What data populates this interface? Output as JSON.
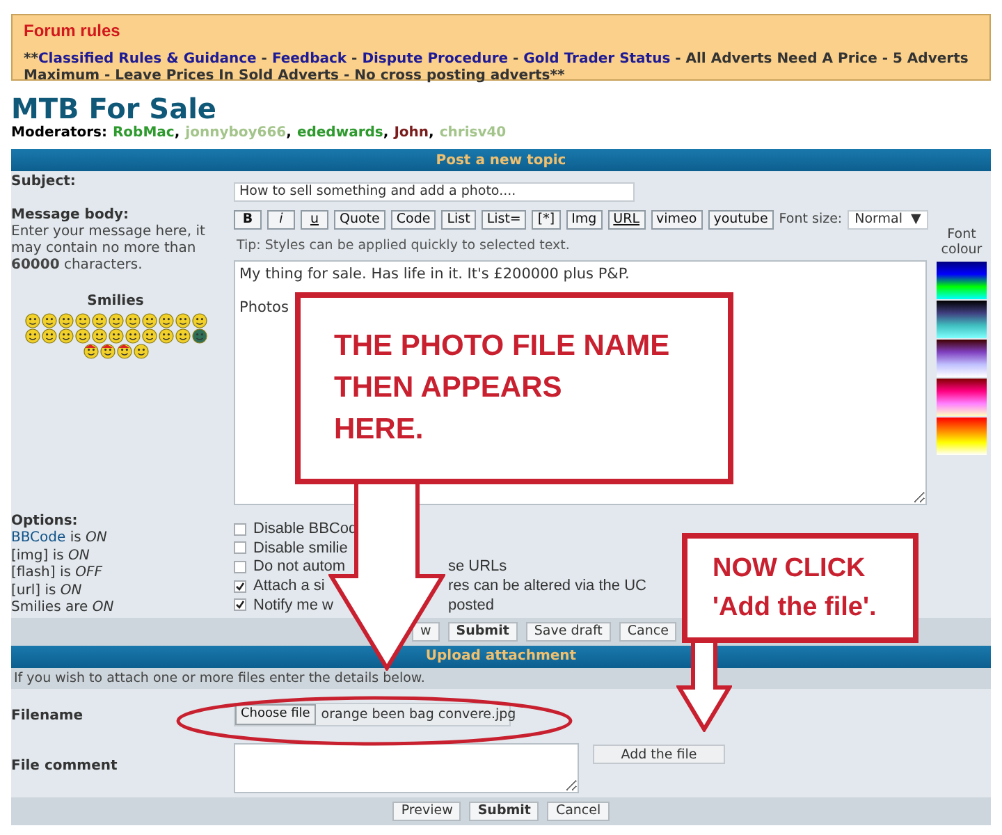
{
  "forum_rules": {
    "title": "Forum rules",
    "parts": [
      {
        "kind": "text",
        "text": "**"
      },
      {
        "kind": "link",
        "text": "Classified Rules & Guidance"
      },
      {
        "kind": "text",
        "text": " - "
      },
      {
        "kind": "link",
        "text": "Feedback"
      },
      {
        "kind": "text",
        "text": " - "
      },
      {
        "kind": "link",
        "text": "Dispute Procedure"
      },
      {
        "kind": "text",
        "text": " - "
      },
      {
        "kind": "link",
        "text": "Gold Trader Status"
      },
      {
        "kind": "text",
        "text": " - All Adverts Need A Price - 5 Adverts Maximum - Leave Prices In Sold Adverts - No cross posting adverts**"
      }
    ]
  },
  "forum_title": "MTB For Sale",
  "moderators": {
    "label": "Moderators:",
    "names": [
      {
        "name": "RobMac",
        "color": "#2e9a2e",
        "separator": ","
      },
      {
        "name": "jonnyboy666",
        "color": "#a3c48a",
        "separator": ","
      },
      {
        "name": "ededwards",
        "color": "#2e9a2e",
        "separator": ","
      },
      {
        "name": "John",
        "color": "#7a1c1c",
        "separator": ","
      },
      {
        "name": "chrisv40",
        "color": "#a3c48a"
      }
    ]
  },
  "post_panel": {
    "title": "Post a new topic",
    "subject": {
      "label": "Subject:",
      "value": "How to sell something and add a photo...."
    },
    "message_body": {
      "label": "Message body:",
      "description": "Enter your message here, it may contain no more than **60000** characters."
    },
    "smilies_title": "Smilies",
    "toolbar": [
      {
        "label": "B",
        "kind": "bold"
      },
      {
        "label": "i",
        "kind": "italic"
      },
      {
        "label": "u",
        "kind": "underline"
      },
      {
        "label": "Quote",
        "kind": "plain"
      },
      {
        "label": "Code",
        "kind": "plain"
      },
      {
        "label": "List",
        "kind": "plain"
      },
      {
        "label": "List=",
        "kind": "plain"
      },
      {
        "label": "[*]",
        "kind": "plain"
      },
      {
        "label": "Img",
        "kind": "plain"
      },
      {
        "label": "URL",
        "kind": "underline"
      },
      {
        "label": "vimeo",
        "kind": "plain"
      },
      {
        "label": "youtube",
        "kind": "plain"
      }
    ],
    "font_size": {
      "label": "Font size:",
      "value": "Normal",
      "arrow": "▼"
    },
    "tip": "Tip: Styles can be applied quickly to selected text.",
    "font_colour_label": "Font colour",
    "message": "My thing for sale. Has life in it. It's £200000 plus P&P.\n\nPhotos",
    "options": {
      "label": "Options:",
      "items": [
        {
          "link": "BBCode",
          "text": " is *ON*"
        },
        {
          "text": "[img] is *ON*"
        },
        {
          "text": "[flash] is *OFF*"
        },
        {
          "text": "[url] is *ON*"
        },
        {
          "text": "Smilies are *ON*"
        }
      ]
    },
    "checkboxes": [
      {
        "text": "Disable BBCod",
        "checked": false
      },
      {
        "text": "Disable smilie",
        "checked": false
      },
      {
        "text": "Do not autom",
        "text_after": "se URLs",
        "checked": false
      },
      {
        "text": "Attach a si",
        "text_after": "res can be altered via the UC",
        "checked": true
      },
      {
        "text": "Notify me w",
        "text_after": "posted",
        "checked": true
      }
    ],
    "buttons": [
      {
        "label": "w",
        "kind": "normal"
      },
      {
        "label": "Submit",
        "kind": "primary"
      },
      {
        "label": "Save draft",
        "kind": "normal"
      },
      {
        "label": "Cance",
        "kind": "normal"
      }
    ]
  },
  "upload_panel": {
    "title": "Upload attachment",
    "info": "If you wish to attach one or more files enter the details below.",
    "filename_label": "Filename",
    "choose_button": "Choose file",
    "file_name": "orange been bag convere.jpg",
    "add_button": "Add the file",
    "comment_label": "File comment",
    "buttons": [
      {
        "label": "Preview",
        "kind": "normal"
      },
      {
        "label": "Submit",
        "kind": "primary"
      },
      {
        "label": "Cancel",
        "kind": "normal"
      }
    ]
  },
  "annotations": [
    {
      "kind": "callout",
      "lines": [
        "THE PHOTO FILE NAME",
        "THEN APPEARS",
        "HERE."
      ]
    },
    {
      "kind": "callout",
      "lines": [
        "NOW CLICK",
        "'Add the file'."
      ]
    }
  ]
}
